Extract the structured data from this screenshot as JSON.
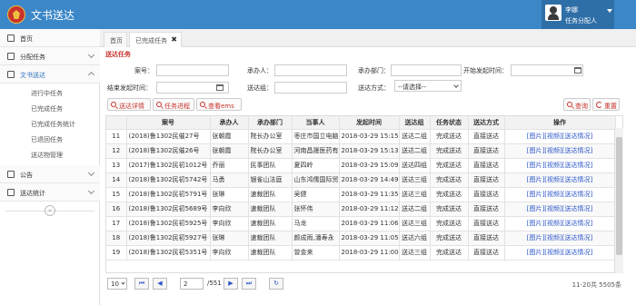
{
  "header": {
    "app_title": "文书送达",
    "user_name": "李娜",
    "user_role": "任务分配人"
  },
  "sidebar": {
    "items": [
      {
        "label": "首页"
      },
      {
        "label": "分配任务"
      },
      {
        "label": "文书送达"
      },
      {
        "label": "公告"
      },
      {
        "label": "送达统计"
      }
    ],
    "sub_items": [
      {
        "label": "进行中任务"
      },
      {
        "label": "已完成任务"
      },
      {
        "label": "已完成任务统计"
      },
      {
        "label": "已退回任务"
      },
      {
        "label": "送达物管理"
      }
    ],
    "collapse_glyph": "«"
  },
  "tabs": [
    {
      "label": "首页"
    },
    {
      "label": "已完成任务",
      "close": "✖"
    }
  ],
  "section_title": "送达任务",
  "form": {
    "case_no_label": "案号：",
    "contractor_label": "承办人：",
    "department_label": "承办部门：",
    "start_time_label": "开始发起时间：",
    "end_time_label": "结束发起时间：",
    "group_label": "送达组：",
    "method_label": "送达方式：",
    "method_value": "--请选择--"
  },
  "toolbar": {
    "detail_label": "送达详情",
    "progress_label": "任务进程",
    "ems_label": "查看ems",
    "query_label": "查询",
    "reset_label": "重置"
  },
  "table": {
    "headers": [
      "",
      "案号",
      "承办人",
      "承办部门",
      "当事人",
      "发起时间",
      "送达组",
      "任务状态",
      "送达方式",
      "操作"
    ],
    "rows": [
      [
        "11",
        "(2018)鲁1302民催27号",
        "张朝霞",
        "院长办公室",
        "枣庄市国立电脑",
        "2018-03-29 15:15:4",
        "送达二组",
        "完成送达",
        "直接送达"
      ],
      [
        "12",
        "(2018)鲁1302民催26号",
        "张朝霞",
        "院长办公室",
        "河南昌晟医药有",
        "2018-03-29 15:13:5",
        "送达二组",
        "完成送达",
        "直接送达"
      ],
      [
        "13",
        "(2017)鲁1302民初1012号",
        "乔丽",
        "民事团队",
        "夏四岭",
        "2018-03-29 15:09:",
        "送达四组",
        "完成送达",
        "直接送达"
      ],
      [
        "14",
        "(2018)鲁1302民初5742号",
        "马勇",
        "银雀山法庭",
        "山东鸿儒国际贸",
        "2018-03-29 14:49:",
        "送达三组",
        "完成送达",
        "直接送达"
      ],
      [
        "15",
        "(2018)鲁1302民初5791号",
        "张琳",
        "速裁团队",
        "吴健",
        "2018-03-29 11:35:",
        "送达三组",
        "完成送达",
        "直接送达"
      ],
      [
        "16",
        "(2018)鲁1302民初5689号",
        "李向欣",
        "速裁团队",
        "张怀伟",
        "2018-03-29 11:12:",
        "送达二组",
        "完成送达",
        "直接送达"
      ],
      [
        "17",
        "(2018)鲁1302民初5925号",
        "李向欣",
        "速裁团队",
        "马龙",
        "2018-03-29 11:06:",
        "送达三组",
        "完成送达",
        "直接送达"
      ],
      [
        "18",
        "(2018)鲁1302民初5927号",
        "张琳",
        "速裁团队",
        "颜成雨,潘寿永",
        "2018-03-29 11:05:",
        "送达六组",
        "完成送达",
        "直接送达"
      ],
      [
        "19",
        "(2018)鲁1302民初5351号",
        "李向欣",
        "速裁团队",
        "曾金来",
        "2018-03-29 11:00:",
        "送达三组",
        "完成送达",
        "直接送达"
      ]
    ],
    "actions": [
      "[图片]",
      "[视频]",
      "[送达情况]"
    ]
  },
  "pager": {
    "page_size": "10",
    "first": "⏮",
    "prev": "◀",
    "current_page": "2",
    "total_pages": "/551",
    "next": "▶",
    "last": "⏭",
    "refresh": "↻",
    "summary": "11-20共 5505条"
  }
}
